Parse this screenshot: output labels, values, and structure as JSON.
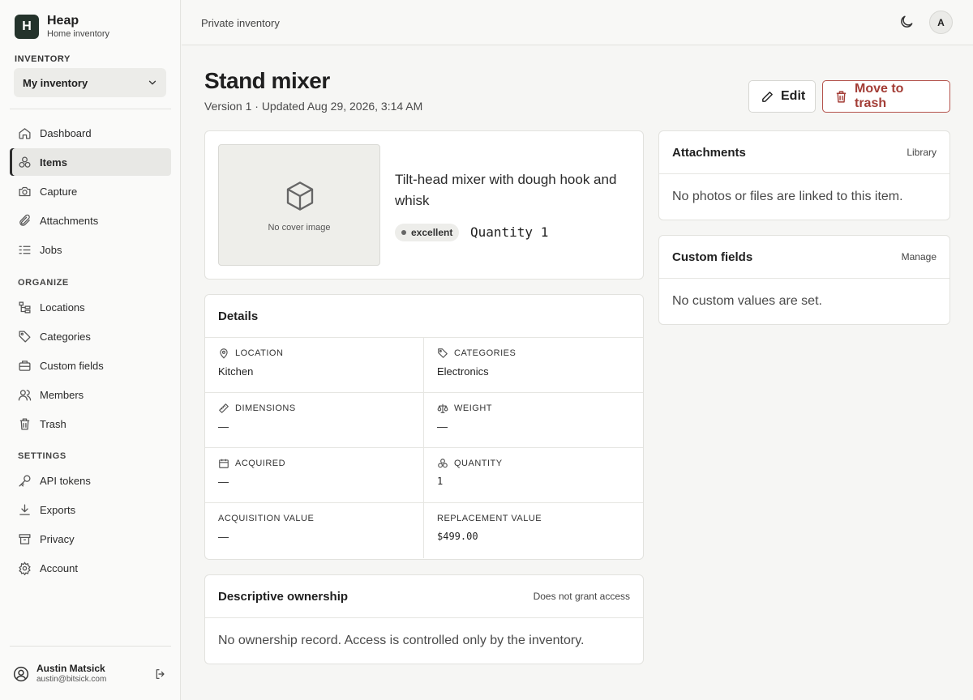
{
  "brand": {
    "logo_letter": "H",
    "name": "Heap",
    "subtitle": "Home inventory"
  },
  "inventory": {
    "label": "INVENTORY",
    "selected": "My inventory"
  },
  "nav": {
    "main": [
      {
        "label": "Dashboard",
        "icon": "home-icon"
      },
      {
        "label": "Items",
        "icon": "items-icon",
        "active": true
      },
      {
        "label": "Capture",
        "icon": "camera-icon"
      },
      {
        "label": "Attachments",
        "icon": "paperclip-icon"
      },
      {
        "label": "Jobs",
        "icon": "list-icon"
      }
    ],
    "organize_label": "ORGANIZE",
    "organize": [
      {
        "label": "Locations",
        "icon": "hierarchy-icon"
      },
      {
        "label": "Categories",
        "icon": "tag-icon"
      },
      {
        "label": "Custom fields",
        "icon": "briefcase-icon"
      },
      {
        "label": "Members",
        "icon": "users-icon"
      },
      {
        "label": "Trash",
        "icon": "trash-icon"
      }
    ],
    "settings_label": "SETTINGS",
    "settings": [
      {
        "label": "API tokens",
        "icon": "key-icon"
      },
      {
        "label": "Exports",
        "icon": "download-icon"
      },
      {
        "label": "Privacy",
        "icon": "archive-icon"
      },
      {
        "label": "Account",
        "icon": "gear-icon"
      }
    ]
  },
  "user": {
    "name": "Austin Matsick",
    "email": "austin@bitsick.com"
  },
  "topbar": {
    "breadcrumb": "Private inventory",
    "avatar_letter": "A"
  },
  "item": {
    "title": "Stand mixer",
    "meta": "Version 1 · Updated Aug 29, 2026, 3:14 AM",
    "edit_label": "Edit",
    "trash_label": "Move to trash",
    "cover_placeholder": "No cover image",
    "description": "Tilt-head mixer with dough hook and whisk",
    "condition": "excellent",
    "quantity_text": "Quantity 1"
  },
  "details": {
    "title": "Details",
    "fields": [
      {
        "label": "LOCATION",
        "value": "Kitchen",
        "icon": "pin-icon"
      },
      {
        "label": "CATEGORIES",
        "value": "Electronics",
        "icon": "tag-icon"
      },
      {
        "label": "DIMENSIONS",
        "value": "—",
        "icon": "ruler-icon"
      },
      {
        "label": "WEIGHT",
        "value": "—",
        "icon": "scale-icon"
      },
      {
        "label": "ACQUIRED",
        "value": "—",
        "icon": "calendar-icon"
      },
      {
        "label": "QUANTITY",
        "value": "1",
        "icon": "items-icon"
      },
      {
        "label": "ACQUISITION VALUE",
        "value": "—"
      },
      {
        "label": "REPLACEMENT VALUE",
        "value": "$499.00"
      }
    ]
  },
  "ownership": {
    "title": "Descriptive ownership",
    "note": "Does not grant access",
    "body": "No ownership record. Access is controlled only by the inventory."
  },
  "attachments": {
    "title": "Attachments",
    "link": "Library",
    "body": "No photos or files are linked to this item."
  },
  "custom_fields": {
    "title": "Custom fields",
    "link": "Manage",
    "body": "No custom values are set."
  }
}
